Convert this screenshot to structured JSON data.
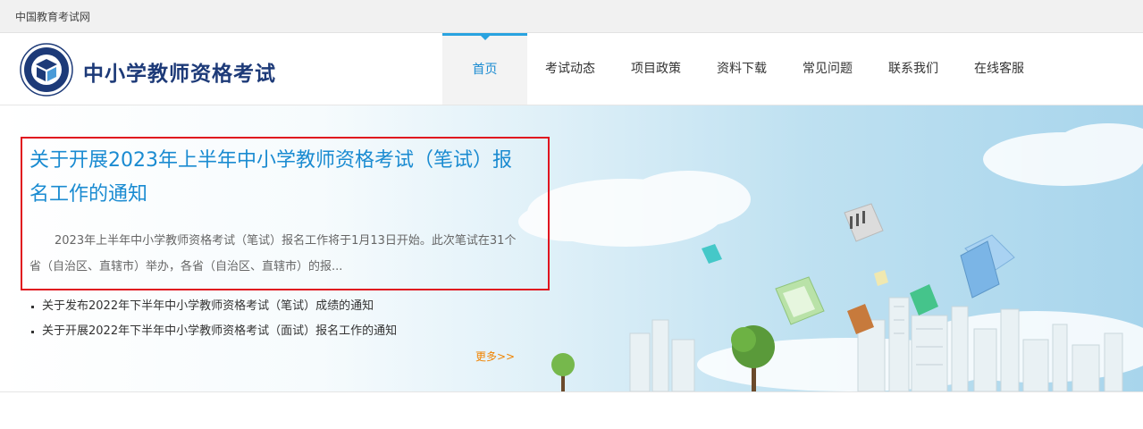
{
  "topbar": {
    "site_name": "中国教育考试网"
  },
  "header": {
    "brand": "中小学教师资格考试"
  },
  "nav": {
    "items": [
      {
        "label": "首页",
        "active": true
      },
      {
        "label": "考试动态"
      },
      {
        "label": "项目政策"
      },
      {
        "label": "资料下载"
      },
      {
        "label": "常见问题"
      },
      {
        "label": "联系我们"
      },
      {
        "label": "在线客服"
      }
    ]
  },
  "featured": {
    "title": "关于开展2023年上半年中小学教师资格考试（笔试）报名工作的通知",
    "summary": "2023年上半年中小学教师资格考试（笔试）报名工作将于1月13日开始。此次笔试在31个省（自治区、直辖市）举办，各省（自治区、直辖市）的报..."
  },
  "news": [
    {
      "title": "关于发布2022年下半年中小学教师资格考试（笔试）成绩的通知"
    },
    {
      "title": "关于开展2022年下半年中小学教师资格考试（面试）报名工作的通知"
    }
  ],
  "more_link": "更多>>",
  "colors": {
    "nav_active": "#1a8bd1",
    "brand": "#1d3a78",
    "highlight_border": "#e0141f",
    "more_link": "#f08300"
  }
}
